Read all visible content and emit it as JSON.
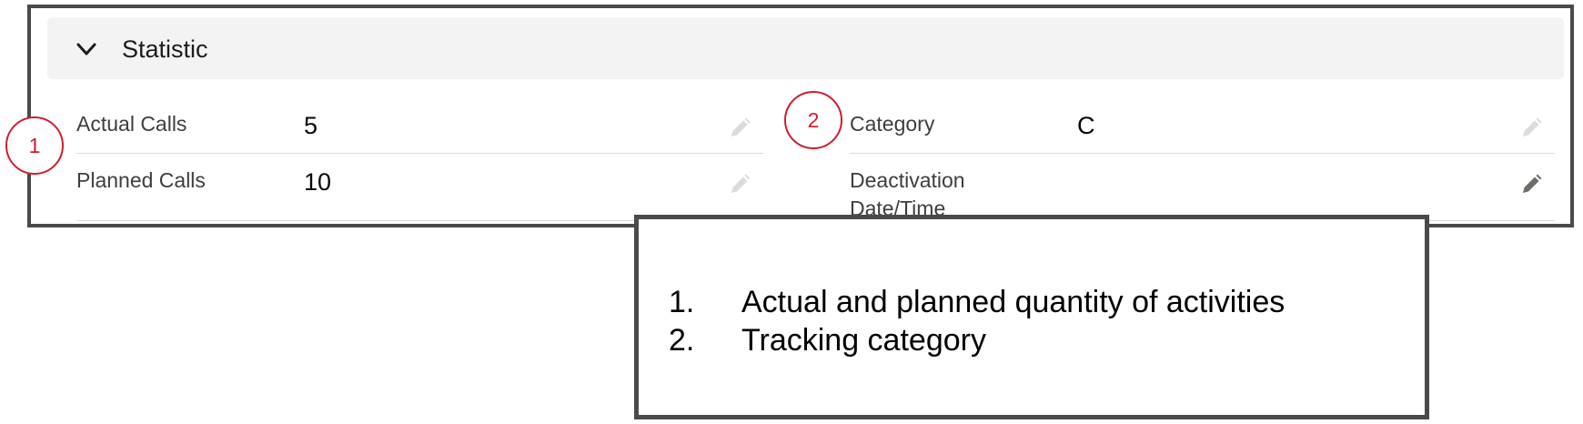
{
  "section": {
    "title": "Statistic",
    "chevron_icon": "chevron-down-icon"
  },
  "fields": {
    "actual_calls": {
      "label": "Actual Calls",
      "value": "5"
    },
    "planned_calls": {
      "label": "Planned Calls",
      "value": "10"
    },
    "category": {
      "label": "Category",
      "value": "C"
    },
    "deactivation": {
      "label_line1": "Deactivation",
      "label_line2": "Date/Time",
      "value": ""
    }
  },
  "callouts": {
    "one": "1",
    "two": "2"
  },
  "legend": {
    "items": [
      {
        "number": "1.",
        "text": "Actual and planned quantity of activities"
      },
      {
        "number": "2.",
        "text": "Tracking category"
      }
    ]
  },
  "colors": {
    "callout_red": "#d01e2e",
    "frame_border": "#4a4a4a",
    "header_bg": "#f3f3f3",
    "pencil_disabled": "#dddbda",
    "pencil_active": "#706e6b"
  }
}
